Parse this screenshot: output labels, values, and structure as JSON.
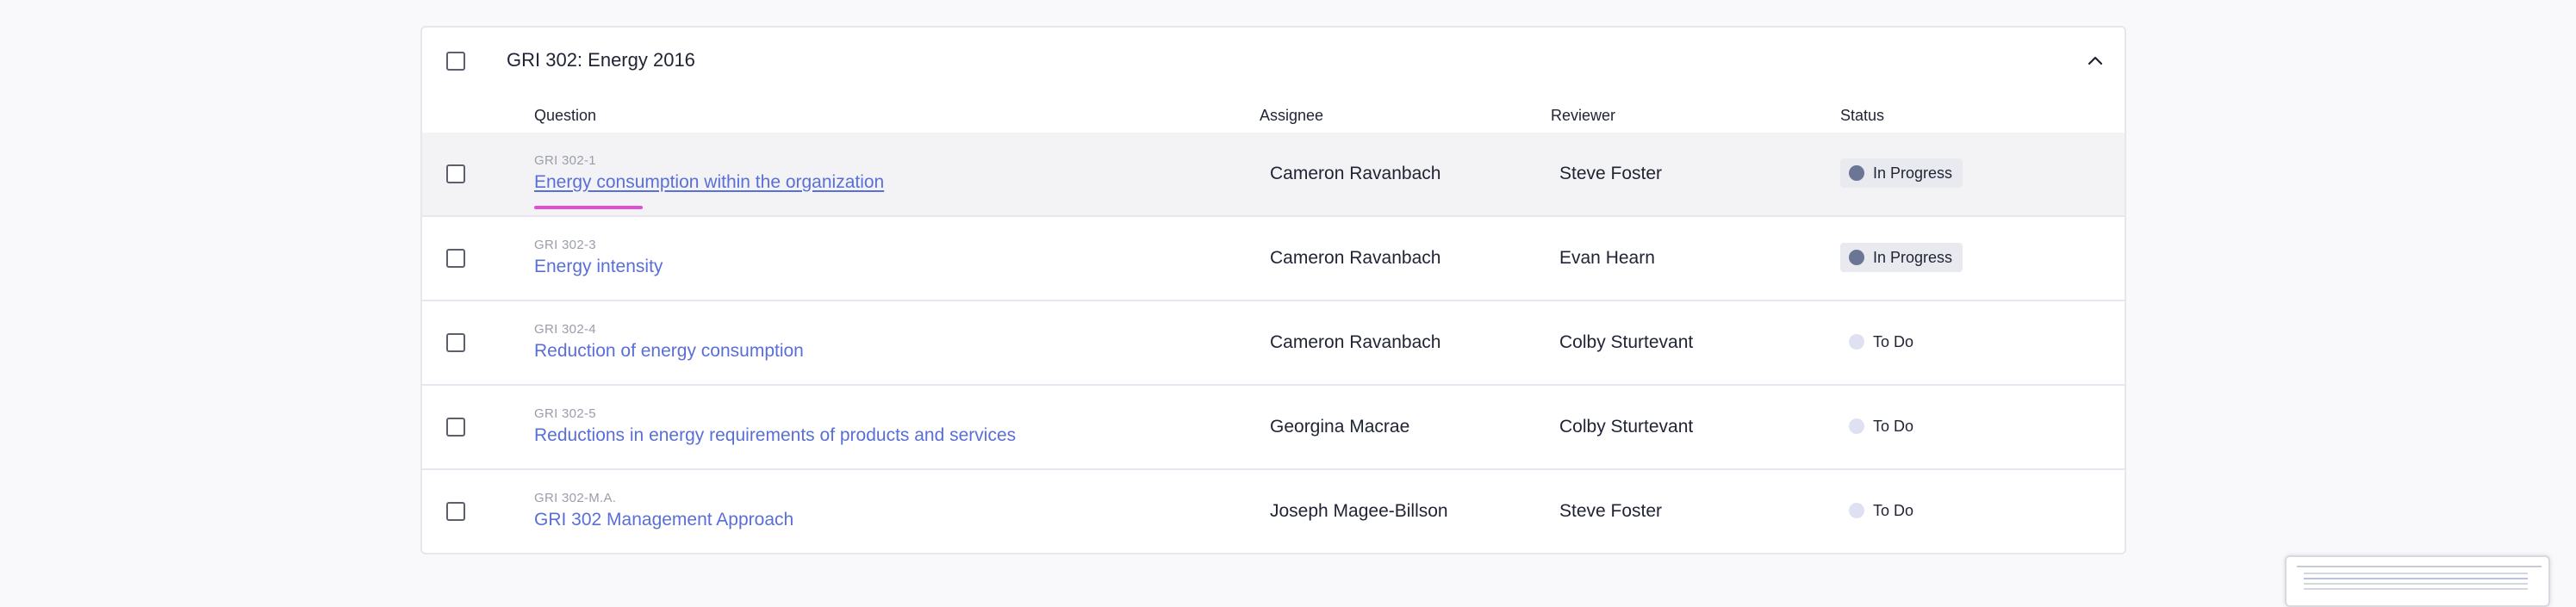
{
  "group": {
    "title": "GRI 302: Energy 2016",
    "expanded": true
  },
  "columns": {
    "question": "Question",
    "assignee": "Assignee",
    "reviewer": "Reviewer",
    "status": "Status"
  },
  "rows": [
    {
      "code": "GRI 302-1",
      "title": "Energy consumption within the organization",
      "assignee": "Cameron Ravanbach",
      "reviewer": "Steve Foster",
      "status": "In Progress"
    },
    {
      "code": "GRI 302-3",
      "title": "Energy intensity",
      "assignee": "Cameron Ravanbach",
      "reviewer": "Evan Hearn",
      "status": "In Progress"
    },
    {
      "code": "GRI 302-4",
      "title": "Reduction of energy consumption",
      "assignee": "Cameron Ravanbach",
      "reviewer": "Colby Sturtevant",
      "status": "To Do"
    },
    {
      "code": "GRI 302-5",
      "title": "Reductions in energy requirements of products and services",
      "assignee": "Georgina Macrae",
      "reviewer": "Colby Sturtevant",
      "status": "To Do"
    },
    {
      "code": "GRI 302-M.A.",
      "title": "GRI 302 Management Approach",
      "assignee": "Joseph Magee-Billson",
      "reviewer": "Steve Foster",
      "status": "To Do"
    }
  ],
  "colors": {
    "link": "#5a6fd6",
    "in_progress_dot": "#6b7594",
    "todo_dot": "#dfe1f2",
    "focus_underline": "#e14ed8"
  },
  "icons": {
    "collapse": "chevron-up-icon"
  }
}
